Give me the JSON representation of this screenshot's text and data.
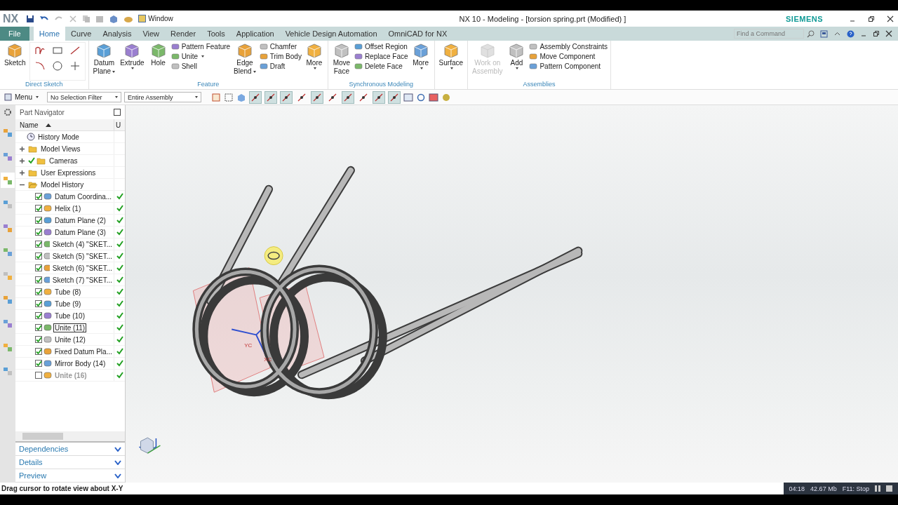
{
  "title_bar": {
    "logo": "NX",
    "window_menu": "Window",
    "title": "NX 10 - Modeling - [torsion spring.prt (Modified) ]",
    "brand": "SIEMENS"
  },
  "tabs": [
    {
      "label": "File",
      "kind": "file",
      "selected": false
    },
    {
      "label": "Home",
      "kind": "tab",
      "selected": true
    },
    {
      "label": "Curve",
      "kind": "tab",
      "selected": false
    },
    {
      "label": "Analysis",
      "kind": "tab",
      "selected": false
    },
    {
      "label": "View",
      "kind": "tab",
      "selected": false
    },
    {
      "label": "Render",
      "kind": "tab",
      "selected": false
    },
    {
      "label": "Tools",
      "kind": "tab",
      "selected": false
    },
    {
      "label": "Application",
      "kind": "tab",
      "selected": false
    },
    {
      "label": "Vehicle Design Automation",
      "kind": "tab",
      "selected": false
    },
    {
      "label": "OmniCAD for NX",
      "kind": "tab",
      "selected": false
    }
  ],
  "search": {
    "placeholder": "Find a Command"
  },
  "ribbon_groups": [
    {
      "label": "Direct Sketch",
      "items": [
        {
          "kind": "large",
          "lines": [
            "Sketch"
          ],
          "dropdown": false,
          "disabled": false
        },
        {
          "kind": "sketch_tools"
        }
      ]
    },
    {
      "label": "Feature",
      "items": [
        {
          "kind": "large",
          "lines": [
            "Datum",
            "Plane"
          ],
          "dropdown": true,
          "disabled": false
        },
        {
          "kind": "large",
          "lines": [
            "Extrude"
          ],
          "dropdown": true,
          "disabled": false
        },
        {
          "kind": "large",
          "lines": [
            "Hole"
          ],
          "dropdown": false,
          "disabled": false
        },
        {
          "kind": "list",
          "entries": [
            {
              "label": "Pattern Feature",
              "dropdown": false
            },
            {
              "label": "Unite",
              "dropdown": true
            },
            {
              "label": "Shell",
              "dropdown": false
            }
          ]
        },
        {
          "kind": "large",
          "lines": [
            "Edge",
            "Blend"
          ],
          "dropdown": true,
          "disabled": false
        },
        {
          "kind": "list",
          "entries": [
            {
              "label": "Chamfer",
              "dropdown": false
            },
            {
              "label": "Trim Body",
              "dropdown": false
            },
            {
              "label": "Draft",
              "dropdown": false
            }
          ]
        },
        {
          "kind": "large",
          "lines": [
            "More"
          ],
          "dropdown": true,
          "disabled": false
        }
      ]
    },
    {
      "label": "Synchronous Modeling",
      "items": [
        {
          "kind": "large",
          "lines": [
            "Move",
            "Face"
          ],
          "dropdown": false,
          "disabled": false
        },
        {
          "kind": "list",
          "entries": [
            {
              "label": "Offset Region",
              "dropdown": false
            },
            {
              "label": "Replace Face",
              "dropdown": false
            },
            {
              "label": "Delete Face",
              "dropdown": false
            }
          ]
        },
        {
          "kind": "large",
          "lines": [
            "More"
          ],
          "dropdown": true,
          "disabled": false
        }
      ]
    },
    {
      "items": [
        {
          "kind": "large",
          "lines": [
            "Surface"
          ],
          "dropdown": true,
          "disabled": false
        }
      ]
    },
    {
      "label": "Assemblies",
      "items": [
        {
          "kind": "large",
          "lines": [
            "Work on",
            "Assembly"
          ],
          "dropdown": false,
          "disabled": true
        },
        {
          "kind": "large",
          "lines": [
            "Add"
          ],
          "dropdown": true,
          "disabled": false
        },
        {
          "kind": "list",
          "entries": [
            {
              "label": "Assembly Constraints",
              "dropdown": false
            },
            {
              "label": "Move Component",
              "dropdown": false
            },
            {
              "label": "Pattern Component",
              "dropdown": false
            }
          ]
        }
      ]
    }
  ],
  "toolbar": {
    "menu": "Menu",
    "selection_filter": "No Selection Filter",
    "scope": "Entire Assembly",
    "snap_buttons": [
      {
        "on": true
      },
      {
        "on": true
      },
      {
        "on": true
      },
      {
        "on": false
      },
      {
        "on": true
      },
      {
        "on": false
      },
      {
        "on": true
      },
      {
        "on": false
      },
      {
        "on": true
      },
      {
        "on": true
      }
    ]
  },
  "resource_bar": [
    {
      "selected": false
    },
    {
      "selected": false
    },
    {
      "selected": true
    },
    {
      "selected": false
    },
    {
      "selected": false
    },
    {
      "selected": false
    },
    {
      "selected": false
    },
    {
      "selected": false
    },
    {
      "selected": false
    },
    {
      "selected": false
    },
    {
      "selected": false
    }
  ],
  "part_navigator": {
    "title": "Part Navigator",
    "columns": [
      "Name",
      "U"
    ],
    "nodes": [
      {
        "label": "History Mode",
        "kind": "leaf",
        "shown": false
      },
      {
        "label": "Model Views",
        "kind": "folder",
        "expanded": false,
        "shown": false
      },
      {
        "label": "Cameras",
        "kind": "folder",
        "expanded": false,
        "shown": true
      },
      {
        "label": "User Expressions",
        "kind": "folder",
        "expanded": false,
        "shown": false
      },
      {
        "label": "Model History",
        "kind": "folder",
        "expanded": true,
        "shown": false,
        "children": [
          {
            "label": "Datum Coordina...",
            "checked": true,
            "up_to_date": true,
            "selected": false
          },
          {
            "label": "Helix (1)",
            "checked": true,
            "up_to_date": true,
            "selected": false
          },
          {
            "label": "Datum Plane (2)",
            "checked": true,
            "up_to_date": true,
            "selected": false
          },
          {
            "label": "Datum Plane (3)",
            "checked": true,
            "up_to_date": true,
            "selected": false
          },
          {
            "label": "Sketch (4) \"SKET...",
            "checked": true,
            "up_to_date": true,
            "selected": false
          },
          {
            "label": "Sketch (5) \"SKET...",
            "checked": true,
            "up_to_date": true,
            "selected": false
          },
          {
            "label": "Sketch (6) \"SKET...",
            "checked": true,
            "up_to_date": true,
            "selected": false
          },
          {
            "label": "Sketch (7) \"SKET...",
            "checked": true,
            "up_to_date": true,
            "selected": false
          },
          {
            "label": "Tube (8)",
            "checked": true,
            "up_to_date": true,
            "selected": false
          },
          {
            "label": "Tube (9)",
            "checked": true,
            "up_to_date": true,
            "selected": false
          },
          {
            "label": "Tube (10)",
            "checked": true,
            "up_to_date": true,
            "selected": false
          },
          {
            "label": "Unite (11)",
            "checked": true,
            "up_to_date": true,
            "selected": true
          },
          {
            "label": "Unite (12)",
            "checked": true,
            "up_to_date": true,
            "selected": false
          },
          {
            "label": "Fixed Datum Pla...",
            "checked": true,
            "up_to_date": true,
            "selected": false
          },
          {
            "label": "Mirror Body (14)",
            "checked": true,
            "up_to_date": true,
            "selected": false
          },
          {
            "label": "Unite (16)",
            "checked": false,
            "up_to_date": true,
            "selected": false
          }
        ]
      }
    ],
    "panels": [
      {
        "label": "Dependencies",
        "expanded": false
      },
      {
        "label": "Details",
        "expanded": false
      },
      {
        "label": "Preview",
        "expanded": false
      }
    ]
  },
  "graphics": {
    "csys_labels": [
      "YC",
      "XC"
    ]
  },
  "status_bar": {
    "message": "Drag cursor to rotate view about X-Y"
  },
  "recorder": {
    "time": "04:18",
    "size": "42.67 Mb",
    "stop_hint": "F11: Stop"
  }
}
